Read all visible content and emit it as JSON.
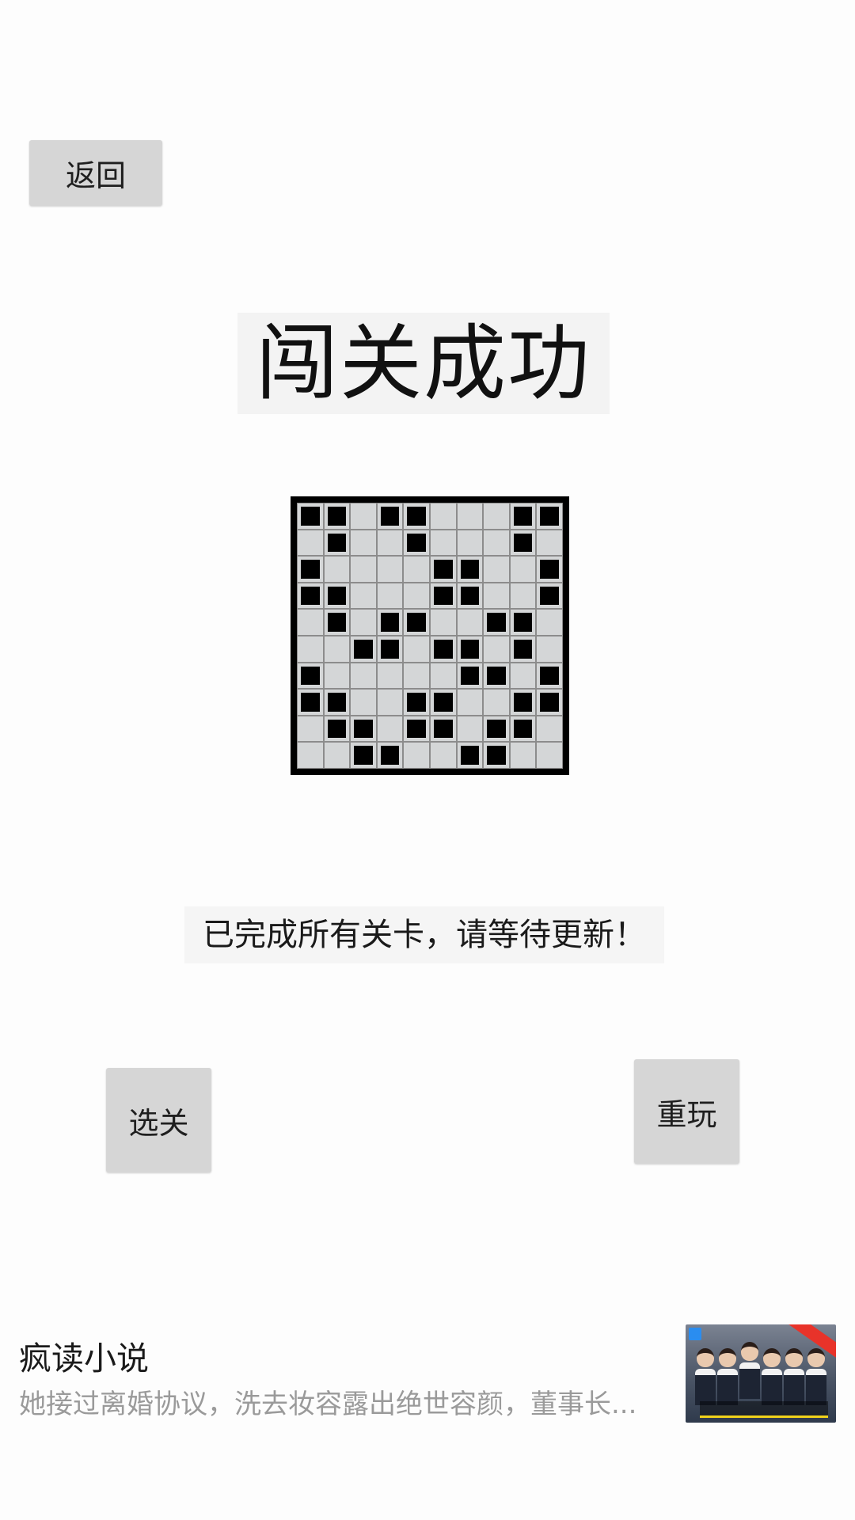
{
  "buttons": {
    "back": "返回",
    "level_select": "选关",
    "replay": "重玩"
  },
  "title": "闯关成功",
  "message": "已完成所有关卡，请等待更新！",
  "board": {
    "rows": 10,
    "cols": 10,
    "cells": [
      [
        1,
        1,
        0,
        1,
        1,
        0,
        0,
        0,
        1,
        1
      ],
      [
        0,
        1,
        0,
        0,
        1,
        0,
        0,
        0,
        1,
        0
      ],
      [
        1,
        0,
        0,
        0,
        0,
        1,
        1,
        0,
        0,
        1
      ],
      [
        1,
        1,
        0,
        0,
        0,
        1,
        1,
        0,
        0,
        1
      ],
      [
        0,
        1,
        0,
        1,
        1,
        0,
        0,
        1,
        1,
        0
      ],
      [
        0,
        0,
        1,
        1,
        0,
        1,
        1,
        0,
        1,
        0
      ],
      [
        1,
        0,
        0,
        0,
        0,
        0,
        1,
        1,
        0,
        1
      ],
      [
        1,
        1,
        0,
        0,
        1,
        1,
        0,
        0,
        1,
        1
      ],
      [
        0,
        1,
        1,
        0,
        1,
        1,
        0,
        1,
        1,
        0
      ],
      [
        0,
        0,
        1,
        1,
        0,
        0,
        1,
        1,
        0,
        0
      ]
    ]
  },
  "ad": {
    "title": "疯读小说",
    "description": "她接过离婚协议，洗去妆容露出绝世容颜，董事长..."
  }
}
